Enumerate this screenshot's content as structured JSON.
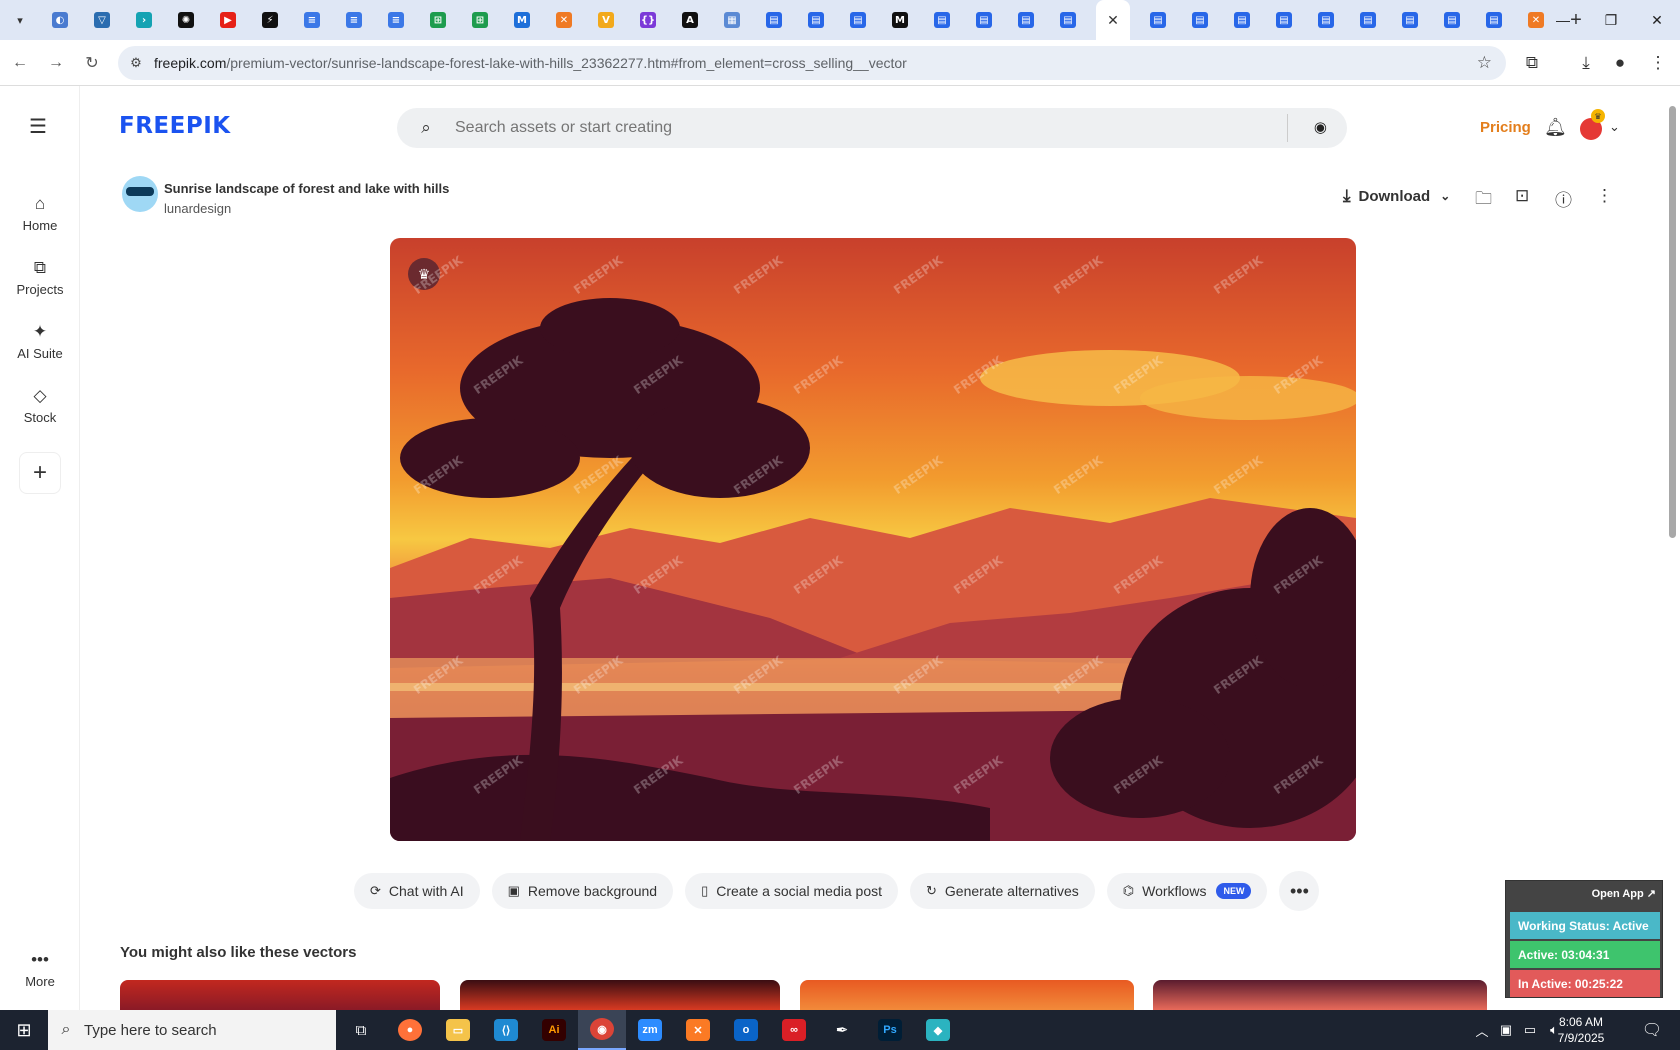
{
  "browser": {
    "tabs": [
      {
        "icon": "compass-icon",
        "color": "#4a7bd0"
      },
      {
        "icon": "vpn-icon",
        "color": "#2b6db0"
      },
      {
        "icon": "chevron-app-icon",
        "color": "#15a3b3"
      },
      {
        "icon": "openai-icon",
        "color": "#111111"
      },
      {
        "icon": "youtube-icon",
        "color": "#e62117"
      },
      {
        "icon": "bolt-icon",
        "color": "#111111"
      },
      {
        "icon": "docs-icon",
        "color": "#3b78e7"
      },
      {
        "icon": "docs-icon",
        "color": "#3b78e7"
      },
      {
        "icon": "docs-icon",
        "color": "#3b78e7"
      },
      {
        "icon": "sheets-icon",
        "color": "#1e9c4e"
      },
      {
        "icon": "sheets-icon",
        "color": "#1e9c4e"
      },
      {
        "icon": "ms-icon",
        "color": "#1e6fd9"
      },
      {
        "icon": "xampp-icon",
        "color": "#ef7a24"
      },
      {
        "icon": "v-icon",
        "color": "#f2a91b"
      },
      {
        "icon": "code-brackets-icon",
        "color": "#7c3ad8"
      },
      {
        "icon": "a-icon",
        "color": "#111111"
      },
      {
        "icon": "grid-icon",
        "color": "#5b8ad4"
      },
      {
        "icon": "forms-icon",
        "color": "#2867e8"
      },
      {
        "icon": "forms-icon",
        "color": "#2867e8"
      },
      {
        "icon": "forms-icon",
        "color": "#2867e8"
      },
      {
        "icon": "m-icon",
        "color": "#111111"
      },
      {
        "icon": "forms-icon",
        "color": "#2867e8"
      },
      {
        "icon": "forms-icon",
        "color": "#2867e8"
      },
      {
        "icon": "forms-icon",
        "color": "#2867e8"
      },
      {
        "icon": "forms-icon",
        "color": "#2867e8"
      },
      {
        "icon": "close-icon",
        "color": "#ffffff",
        "active": true
      },
      {
        "icon": "forms-icon",
        "color": "#2867e8"
      },
      {
        "icon": "forms-icon",
        "color": "#2867e8"
      },
      {
        "icon": "forms-icon",
        "color": "#2867e8"
      },
      {
        "icon": "forms-icon",
        "color": "#2867e8"
      },
      {
        "icon": "forms-icon",
        "color": "#2867e8"
      },
      {
        "icon": "forms-icon",
        "color": "#2867e8"
      },
      {
        "icon": "forms-icon",
        "color": "#2867e8"
      },
      {
        "icon": "forms-icon",
        "color": "#2867e8"
      },
      {
        "icon": "forms-icon",
        "color": "#2867e8"
      },
      {
        "icon": "xampp-icon",
        "color": "#ef7a24"
      }
    ],
    "url_host": "freepik.com",
    "url_path": "/premium-vector/sunrise-landscape-forest-lake-with-hills_23362277.htm#from_element=cross_selling__vector"
  },
  "site": {
    "logo": "FREEPIK",
    "search_placeholder": "Search assets or start creating",
    "pricing": "Pricing",
    "accent": "#e37e1c",
    "brand": "#1b53f0"
  },
  "nav": {
    "home": "Home",
    "projects": "Projects",
    "ai_suite": "AI Suite",
    "stock": "Stock",
    "more": "More"
  },
  "asset": {
    "title": "Sunrise landscape of forest and lake with hills",
    "author": "lunardesign",
    "download": "Download",
    "watermark": "FREEPIK"
  },
  "tools": {
    "chat": "Chat with AI",
    "remove_bg": "Remove background",
    "social": "Create a social media post",
    "alternatives": "Generate alternatives",
    "workflows": "Workflows",
    "new_badge": "NEW"
  },
  "related": {
    "title": "You might also like these vectors"
  },
  "widget": {
    "open_app": "Open App ↗",
    "status": "Working Status: Active",
    "active": "Active: 03:04:31",
    "inactive": "In Active: 00:25:22",
    "status_color": "#4ab8c8",
    "active_color": "#3ec46d",
    "inactive_color": "#e25a5a"
  },
  "taskbar": {
    "search_placeholder": "Type here to search",
    "time": "8:06 AM",
    "date": "7/9/2025"
  }
}
